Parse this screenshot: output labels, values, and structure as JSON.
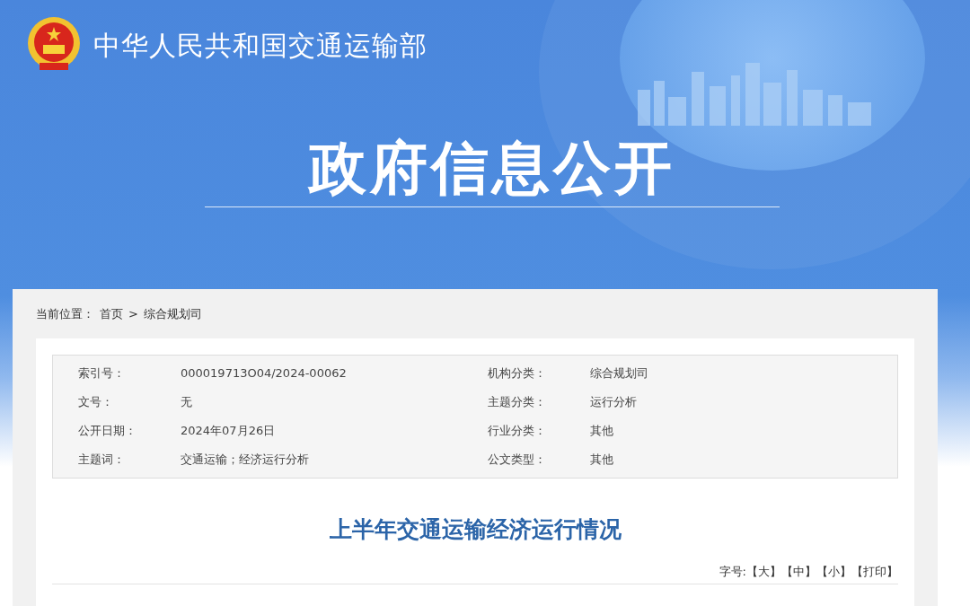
{
  "site_name": "中华人民共和国交通运输部",
  "banner_title": "政府信息公开",
  "breadcrumb": {
    "label": "当前位置：",
    "items": [
      {
        "text": "首页"
      },
      {
        "text": "综合规划司"
      }
    ],
    "separator": ">"
  },
  "meta": [
    {
      "label": "索引号：",
      "value": "000019713O04/2024-00062",
      "label2": "机构分类：",
      "value2": "综合规划司"
    },
    {
      "label": "文号：",
      "value": "无",
      "label2": "主题分类：",
      "value2": "运行分析"
    },
    {
      "label": "公开日期：",
      "value": "2024年07月26日",
      "label2": "行业分类：",
      "value2": "其他"
    },
    {
      "label": "主题词：",
      "value": "交通运输；经济运行分析",
      "label2": "公文类型：",
      "value2": "其他"
    }
  ],
  "article": {
    "title": "上半年交通运输经济运行情况",
    "font_size_label": "字号:",
    "font_size_options": [
      "【大】",
      "【中】",
      "【小】"
    ],
    "print": "【打印】"
  }
}
